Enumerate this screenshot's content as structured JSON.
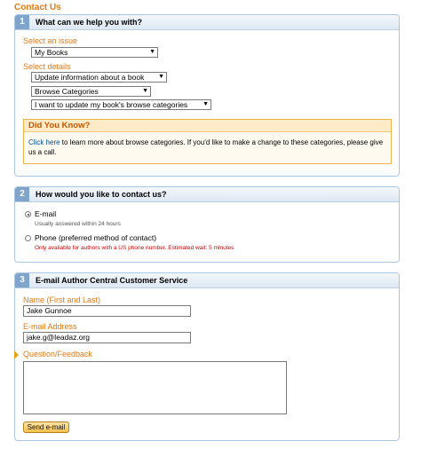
{
  "page": {
    "title": "Contact Us"
  },
  "step1": {
    "number": "1",
    "title": "What can we help you with?",
    "issue_label": "Select an issue",
    "issue_value": "My Books",
    "details_label": "Select details",
    "detail1_value": "Update information about a book",
    "detail2_value": "Browse Categories",
    "detail3_value": "I want to update my book's browse categories",
    "did_you_know": {
      "title": "Did You Know?",
      "link": "Click here",
      "text": " to learn more about browse categories. If you'd like to make a change to these categories, please give us a call."
    }
  },
  "step2": {
    "number": "2",
    "title": "How would you like to contact us?",
    "email_label": "E-mail",
    "email_note": "Usually answered within 24 hours",
    "phone_label": "Phone (preferred method of contact)",
    "phone_note": "Only available for authors with a US phone number. Estimated wait: 5 minutes"
  },
  "step3": {
    "number": "3",
    "title": "E-mail Author Central Customer Service",
    "name_label": "Name (First and Last)",
    "name_value": "Jake Gunnoe",
    "email_label": "E-mail Address",
    "email_value": "jake.g@leadaz.org",
    "question_label": "Question/Feedback",
    "question_value": "",
    "send_label": "Send e-mail"
  },
  "colors": {
    "accent": "#e47911",
    "header": "#7fa5cc",
    "warning_border": "#f0b24b",
    "note_red": "#cc0000"
  }
}
